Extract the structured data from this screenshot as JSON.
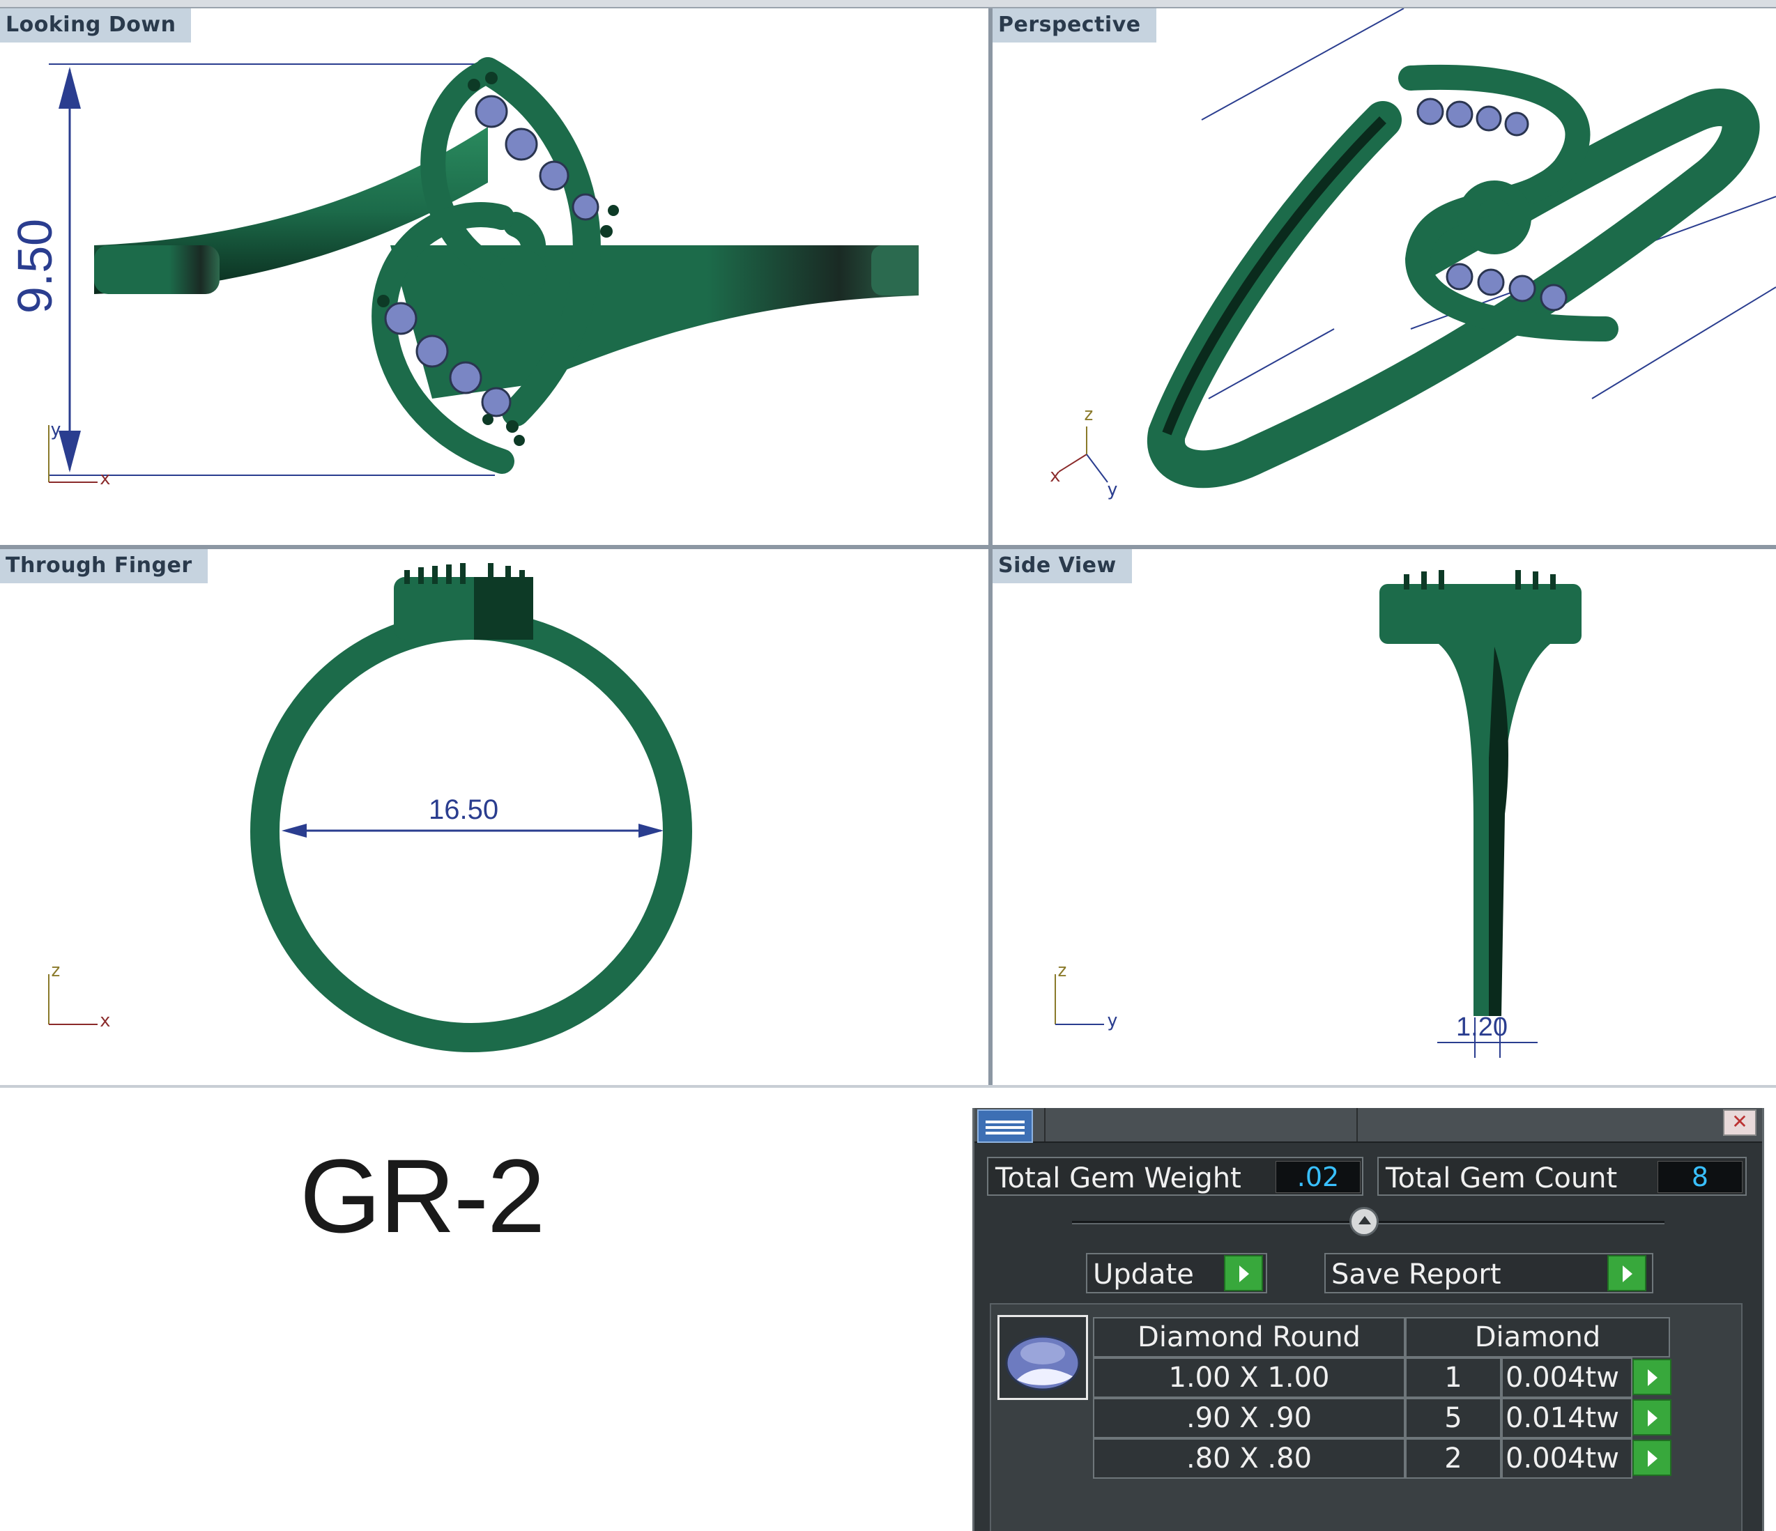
{
  "viewports": {
    "top_left": {
      "label": "Looking Down",
      "dimension": "9.50",
      "axis_a": "y",
      "axis_b": "x"
    },
    "top_right": {
      "label": "Perspective",
      "axis_x": "x",
      "axis_y": "y",
      "axis_z": "z"
    },
    "bottom_left": {
      "label": "Through Finger",
      "dimension": "16.50",
      "axis_a": "z",
      "axis_b": "x"
    },
    "bottom_right": {
      "label": "Side View",
      "dimension": "1.20",
      "axis_a": "z",
      "axis_b": "y"
    }
  },
  "model_code": "GR-2",
  "gem_panel": {
    "total_gem_weight_label": "Total Gem Weight",
    "total_gem_weight_value": ".02",
    "total_gem_count_label": "Total Gem Count",
    "total_gem_count_value": "8",
    "update_label": "Update",
    "save_report_label": "Save Report",
    "close_symbol": "✕",
    "table": {
      "header_shape": "Diamond Round",
      "header_material": "Diamond",
      "rows": [
        {
          "size": "1.00 X 1.00",
          "count": "1",
          "weight": "0.004tw"
        },
        {
          "size": ".90 X .90",
          "count": "5",
          "weight": "0.014tw"
        },
        {
          "size": ".80 X .80",
          "count": "2",
          "weight": "0.004tw"
        }
      ]
    }
  },
  "colors": {
    "metal": "#1c6b4a",
    "metal_dark": "#0d3a26",
    "gem": "#7a86c4",
    "dimension": "#2a3d8f",
    "viewport_label_bg": "#c6d3df",
    "panel_bg": "#2f3437",
    "value_text": "#39c0ff",
    "go_button": "#38a83c"
  },
  "icons": [
    "gem-report-icon",
    "close-icon",
    "collapse-arrow-icon",
    "play-arrow-icon",
    "diamond-round-icon"
  ]
}
